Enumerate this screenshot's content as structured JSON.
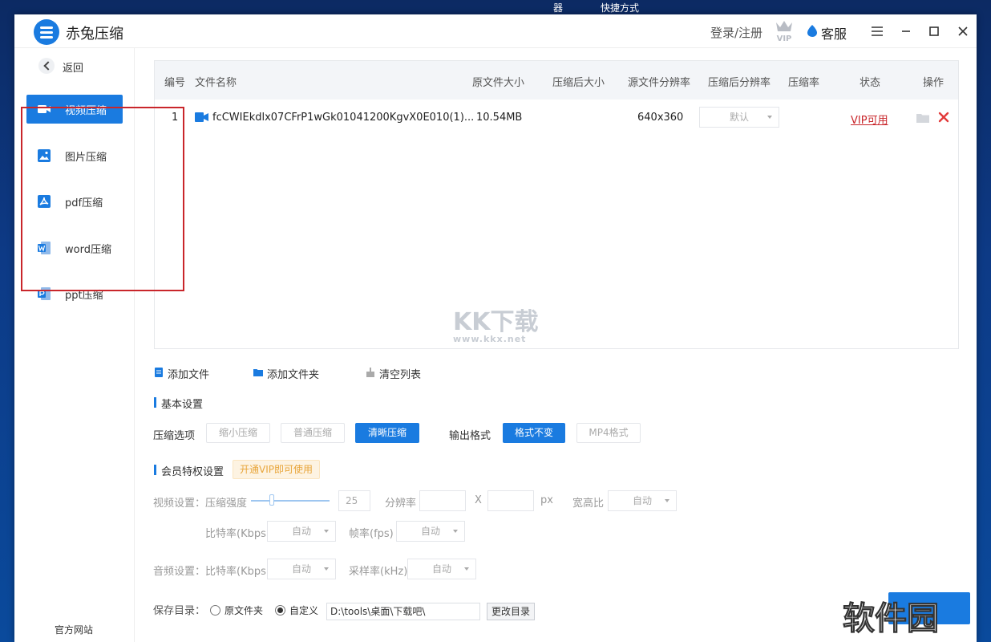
{
  "desktop": {
    "item_1": "器",
    "item_2": "快捷方式"
  },
  "titlebar": {
    "app_title": "赤兔压缩",
    "login": "登录/注册",
    "vip": "VIP",
    "service": "客服"
  },
  "sidebar": {
    "back": "返回",
    "items": [
      {
        "label": "视频压缩",
        "icon": "video-icon",
        "active": true
      },
      {
        "label": "图片压缩",
        "icon": "image-icon"
      },
      {
        "label": "pdf压缩",
        "icon": "pdf-icon"
      },
      {
        "label": "word压缩",
        "icon": "word-icon"
      },
      {
        "label": "ppt压缩",
        "icon": "ppt-icon"
      }
    ],
    "official": "官方网站"
  },
  "table": {
    "headers": [
      "编号",
      "文件名称",
      "原文件大小",
      "压缩后大小",
      "源文件分辨率",
      "压缩后分辨率",
      "压缩率",
      "状态",
      "操作"
    ],
    "rows": [
      {
        "index": "1",
        "name": "fcCWIEkdlx07CFrP1wGk01041200KgvX0E010(1)...",
        "orig_size": "10.54MB",
        "comp_size": "",
        "src_res": "640x360",
        "comp_res": "默认",
        "ratio": "",
        "status": "VIP可用"
      }
    ]
  },
  "watermark": {
    "text": "KK下载",
    "url": "www.kkx.net"
  },
  "actions": {
    "add_file": "添加文件",
    "add_folder": "添加文件夹",
    "clear": "清空列表"
  },
  "basic": {
    "title": "基本设置",
    "compress_label": "压缩选项",
    "options": [
      "缩小压缩",
      "普通压缩",
      "清晰压缩"
    ],
    "selected_option": "清晰压缩",
    "format_label": "输出格式",
    "formats": [
      "格式不变",
      "MP4格式"
    ],
    "selected_format": "格式不变"
  },
  "member": {
    "title": "会员特权设置",
    "tag": "开通VIP即可使用",
    "video_label": "视频设置：",
    "strength_label": "压缩强度",
    "strength_value": "25",
    "resolution_label": "分辨率",
    "x": "X",
    "px": "px",
    "aspect_label": "宽高比",
    "aspect_value": "自动",
    "bitrate_label": "比特率(Kbps)",
    "bitrate_value": "自动",
    "fps_label": "帧率(fps)",
    "fps_value": "自动",
    "audio_label": "音频设置：",
    "audio_bitrate_label": "比特率(Kbps)",
    "audio_bitrate_value": "自动",
    "sample_label": "采样率(kHz)",
    "sample_value": "自动"
  },
  "save": {
    "label": "保存目录：",
    "opt_original": "原文件夹",
    "opt_custom": "自定义",
    "selected": "自定义",
    "path": "D:\\tools\\桌面\\下载吧\\",
    "change": "更改目录"
  },
  "corner_watermark": "软件园",
  "colors": {
    "accent": "#1a7be0",
    "danger": "#c9262b",
    "vip_tag": "#e8a53a",
    "red_box": "#c9262b"
  }
}
